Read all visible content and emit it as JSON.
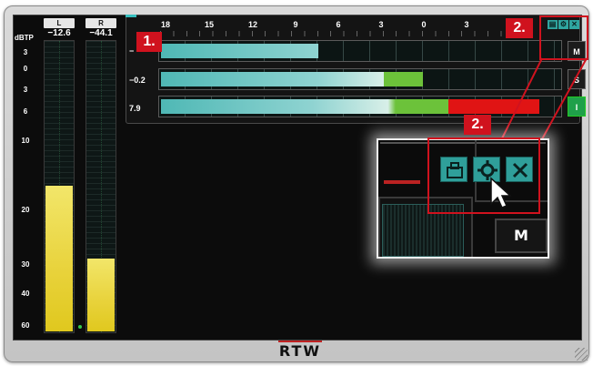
{
  "window": {
    "brand_logo": "RTW"
  },
  "ppm": {
    "unit_label": "dBTP",
    "scale_labels": [
      "3",
      "0",
      "3",
      "6",
      "10",
      "20",
      "30",
      "40",
      "60"
    ],
    "channels": [
      {
        "name": "L",
        "value": "−12.6",
        "level_fraction": 0.5
      },
      {
        "name": "R",
        "value": "−44.1",
        "level_fraction": 0.25
      }
    ]
  },
  "loudness": {
    "scale": [
      "18",
      "15",
      "12",
      "9",
      "6",
      "3",
      "0",
      "3"
    ],
    "rows": [
      {
        "value": "−",
        "button": "M",
        "level_fraction": 0.4
      },
      {
        "value": "−0.2",
        "button": "S",
        "level_fraction": 0.66
      },
      {
        "value": "7.9",
        "button": "I",
        "level_fraction": 0.95
      }
    ]
  },
  "controls": {
    "detach_icon": "detach-icon",
    "settings_icon": "gear-icon",
    "close_icon": "close-icon"
  },
  "callouts": {
    "badge_1": "1.",
    "badge_2_top": "2.",
    "badge_2_zoom": "2."
  },
  "zoom": {
    "button_label": "M"
  },
  "colors": {
    "accent": "#2fa6a0",
    "callout": "#d0121e",
    "ppm_fill": "#e8d23a",
    "bar_fill": "#8fd3d1",
    "bar_green": "#6cc23a",
    "bar_red": "#e01414"
  }
}
